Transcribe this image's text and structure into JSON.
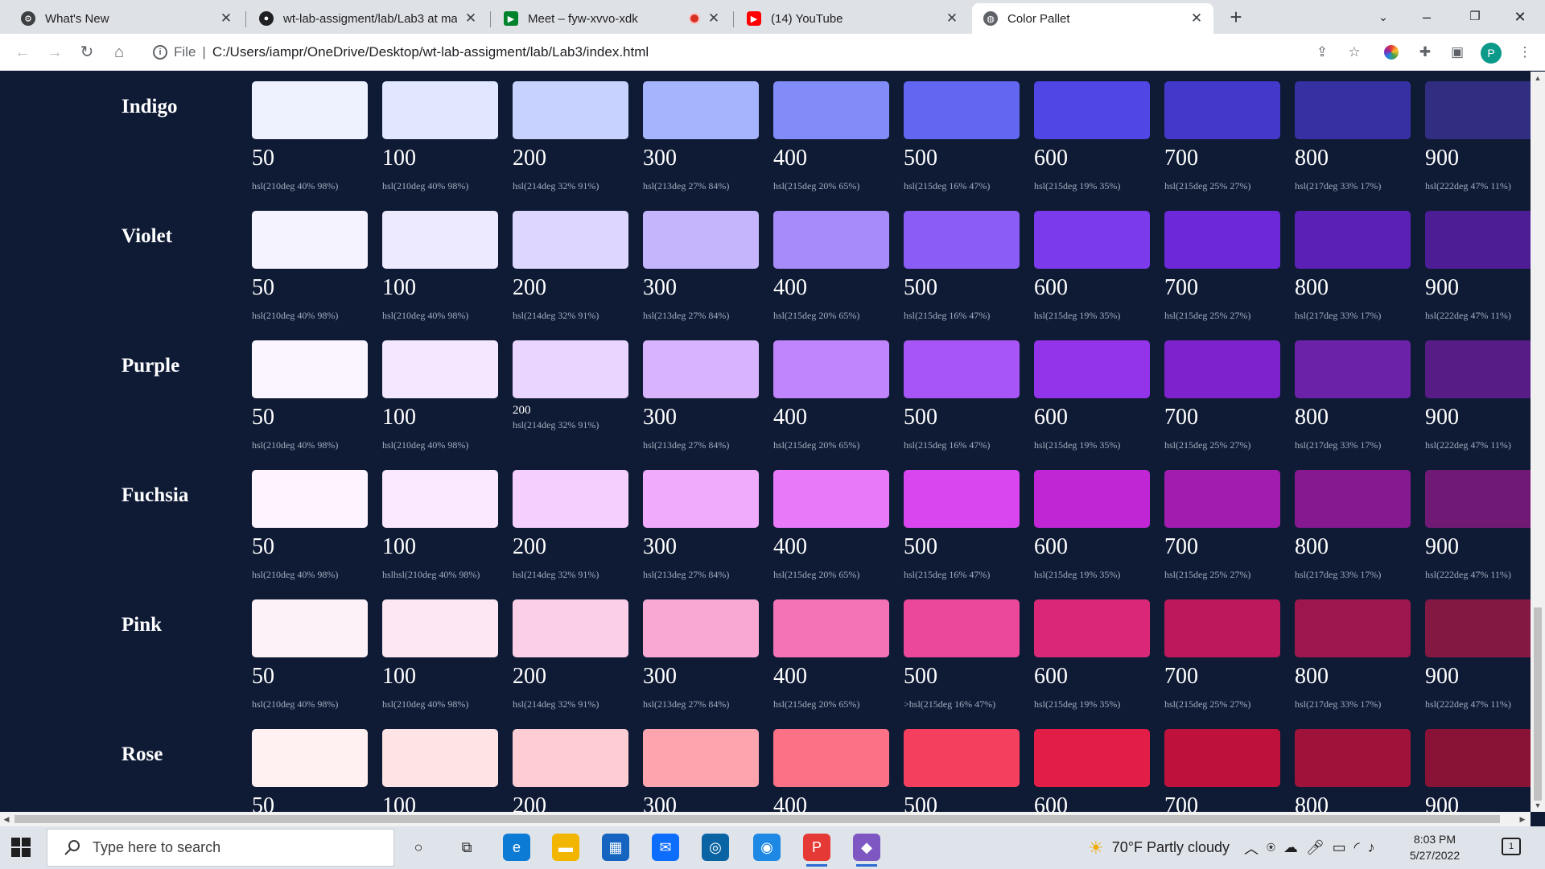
{
  "tabs": [
    {
      "title": "What's New",
      "icon": "settings-gear-icon",
      "icon_color": "#3c4043"
    },
    {
      "title": "wt-lab-assigment/lab/Lab3 at ma",
      "icon": "github-icon",
      "icon_color": "#202124"
    },
    {
      "title": "Meet – fyw-xvvo-xdk",
      "icon": "google-meet-icon",
      "icon_color": "#00832d"
    },
    {
      "title": "(14) YouTube",
      "icon": "youtube-icon",
      "icon_color": "#ff0000"
    },
    {
      "title": "Color Pallet",
      "icon": "globe-icon",
      "icon_color": "#5f6368"
    }
  ],
  "address": {
    "scheme_label": "File",
    "url": "C:/Users/iampr/OneDrive/Desktop/wt-lab-assigment/lab/Lab3/index.html"
  },
  "profile_initial": "P",
  "palettes": [
    {
      "name": "Indigo",
      "colors": [
        "#eef2ff",
        "#e0e7ff",
        "#c7d2fe",
        "#a5b4fc",
        "#818cf8",
        "#6366f1",
        "#4f46e5",
        "#4338ca",
        "#3730a3",
        "#312e81"
      ],
      "labels": [
        {
          "shade": "50",
          "hsl": "hsl(210deg 40% 98%)"
        },
        {
          "shade": "100",
          "hsl": "hsl(210deg 40% 98%)"
        },
        {
          "shade": "200",
          "hsl": "hsl(214deg 32% 91%)"
        },
        {
          "shade": "300",
          "hsl": "hsl(213deg 27% 84%)"
        },
        {
          "shade": "400",
          "hsl": "hsl(215deg 20% 65%)"
        },
        {
          "shade": "500",
          "hsl": "hsl(215deg 16% 47%)"
        },
        {
          "shade": "600",
          "hsl": "hsl(215deg 19% 35%)"
        },
        {
          "shade": "700",
          "hsl": "hsl(215deg 25% 27%)"
        },
        {
          "shade": "800",
          "hsl": "hsl(217deg 33% 17%)"
        },
        {
          "shade": "900",
          "hsl": "hsl(222deg 47% 11%)"
        }
      ]
    },
    {
      "name": "Violet",
      "colors": [
        "#f5f3ff",
        "#ede9fe",
        "#ddd6fe",
        "#c4b5fd",
        "#a78bfa",
        "#8b5cf6",
        "#7c3aed",
        "#6d28d9",
        "#5b21b6",
        "#4c1d95"
      ],
      "labels": [
        {
          "shade": "50",
          "hsl": "hsl(210deg 40% 98%)"
        },
        {
          "shade": "100",
          "hsl": "hsl(210deg 40% 98%)"
        },
        {
          "shade": "200",
          "hsl": "hsl(214deg 32% 91%)"
        },
        {
          "shade": "300",
          "hsl": "hsl(213deg 27% 84%)"
        },
        {
          "shade": "400",
          "hsl": "hsl(215deg 20% 65%)"
        },
        {
          "shade": "500",
          "hsl": "hsl(215deg 16% 47%)"
        },
        {
          "shade": "600",
          "hsl": "hsl(215deg 19% 35%)"
        },
        {
          "shade": "700",
          "hsl": "hsl(215deg 25% 27%)"
        },
        {
          "shade": "800",
          "hsl": "hsl(217deg 33% 17%)"
        },
        {
          "shade": "900",
          "hsl": "hsl(222deg 47% 11%)"
        }
      ]
    },
    {
      "name": "Purple",
      "colors": [
        "#faf5ff",
        "#f3e8ff",
        "#e9d5ff",
        "#d8b4fe",
        "#c084fc",
        "#a855f7",
        "#9333ea",
        "#7e22ce",
        "#6b21a8",
        "#581c87"
      ],
      "labels": [
        {
          "shade": "50",
          "hsl": "hsl(210deg 40% 98%)"
        },
        {
          "shade": "100",
          "hsl": "hsl(210deg 40% 98%)"
        },
        {
          "shade": "200",
          "hsl": "hsl(214deg 32% 91%)",
          "compact": true
        },
        {
          "shade": "300",
          "hsl": "hsl(213deg 27% 84%)"
        },
        {
          "shade": "400",
          "hsl": "hsl(215deg 20% 65%)"
        },
        {
          "shade": "500",
          "hsl": "hsl(215deg 16% 47%)"
        },
        {
          "shade": "600",
          "hsl": "hsl(215deg 19% 35%)"
        },
        {
          "shade": "700",
          "hsl": "hsl(215deg 25% 27%)"
        },
        {
          "shade": "800",
          "hsl": "hsl(217deg 33% 17%)"
        },
        {
          "shade": "900",
          "hsl": "hsl(222deg 47% 11%)"
        }
      ]
    },
    {
      "name": "Fuchsia",
      "colors": [
        "#fdf4ff",
        "#fae8ff",
        "#f5d0fe",
        "#f0abfc",
        "#e879f9",
        "#d946ef",
        "#c026d3",
        "#a21caf",
        "#86198f",
        "#701a75"
      ],
      "labels": [
        {
          "shade": "50",
          "hsl": "hsl(210deg 40% 98%)"
        },
        {
          "shade": "100",
          "hsl": "hslhsl(210deg 40% 98%)"
        },
        {
          "shade": "200",
          "hsl": "hsl(214deg 32% 91%)"
        },
        {
          "shade": "300",
          "hsl": "hsl(213deg 27% 84%)"
        },
        {
          "shade": "400",
          "hsl": "hsl(215deg 20% 65%)"
        },
        {
          "shade": "500",
          "hsl": "hsl(215deg 16% 47%)"
        },
        {
          "shade": "600",
          "hsl": "hsl(215deg 19% 35%)"
        },
        {
          "shade": "700",
          "hsl": "hsl(215deg 25% 27%)"
        },
        {
          "shade": "800",
          "hsl": "hsl(217deg 33% 17%)"
        },
        {
          "shade": "900",
          "hsl": "hsl(222deg 47% 11%)"
        }
      ]
    },
    {
      "name": "Pink",
      "colors": [
        "#fdf2f8",
        "#fce7f3",
        "#fbcfe8",
        "#f9a8d4",
        "#f472b6",
        "#ec4899",
        "#db2777",
        "#be185d",
        "#9d174d",
        "#831843"
      ],
      "labels": [
        {
          "shade": "50",
          "hsl": "hsl(210deg 40% 98%)"
        },
        {
          "shade": "100",
          "hsl": "hsl(210deg 40% 98%)"
        },
        {
          "shade": "200",
          "hsl": "hsl(214deg 32% 91%)"
        },
        {
          "shade": "300",
          "hsl": "hsl(213deg 27% 84%)"
        },
        {
          "shade": "400",
          "hsl": "hsl(215deg 20% 65%)"
        },
        {
          "shade": "500",
          "hsl": ">hsl(215deg 16% 47%)"
        },
        {
          "shade": "600",
          "hsl": "hsl(215deg 19% 35%)"
        },
        {
          "shade": "700",
          "hsl": "hsl(215deg 25% 27%)"
        },
        {
          "shade": "800",
          "hsl": "hsl(217deg 33% 17%)"
        },
        {
          "shade": "900",
          "hsl": "hsl(222deg 47% 11%)"
        }
      ]
    },
    {
      "name": "Rose",
      "colors": [
        "#fff1f2",
        "#ffe4e6",
        "#fecdd3",
        "#fda4af",
        "#fb7185",
        "#f43f5e",
        "#e11d48",
        "#be123c",
        "#9f1239",
        "#881337"
      ],
      "labels": [
        {
          "shade": "50",
          "hsl": ""
        },
        {
          "shade": "100",
          "hsl": ""
        },
        {
          "shade": "200",
          "hsl": ""
        },
        {
          "shade": "300",
          "hsl": ""
        },
        {
          "shade": "400",
          "hsl": ""
        },
        {
          "shade": "500",
          "hsl": ""
        },
        {
          "shade": "600",
          "hsl": ""
        },
        {
          "shade": "700",
          "hsl": ""
        },
        {
          "shade": "800",
          "hsl": ""
        },
        {
          "shade": "900",
          "hsl": ""
        }
      ]
    }
  ],
  "taskbar": {
    "search_placeholder": "Type here to search",
    "weather": "70°F  Partly cloudy",
    "time": "8:03 PM",
    "date": "5/27/2022",
    "notification_count": "1",
    "apps": [
      {
        "name": "cortana-icon",
        "glyph": "○"
      },
      {
        "name": "task-view-icon",
        "glyph": "⧉"
      },
      {
        "name": "edge-icon",
        "glyph": "e"
      },
      {
        "name": "file-explorer-icon",
        "glyph": "▬"
      },
      {
        "name": "microsoft-store-icon",
        "glyph": "▦"
      },
      {
        "name": "mail-icon",
        "glyph": "✉"
      },
      {
        "name": "dell-icon",
        "glyph": "◎"
      },
      {
        "name": "app-icon",
        "glyph": "◉"
      },
      {
        "name": "chrome-icon",
        "glyph": "P"
      },
      {
        "name": "gem-app-icon",
        "glyph": "◆"
      }
    ]
  }
}
